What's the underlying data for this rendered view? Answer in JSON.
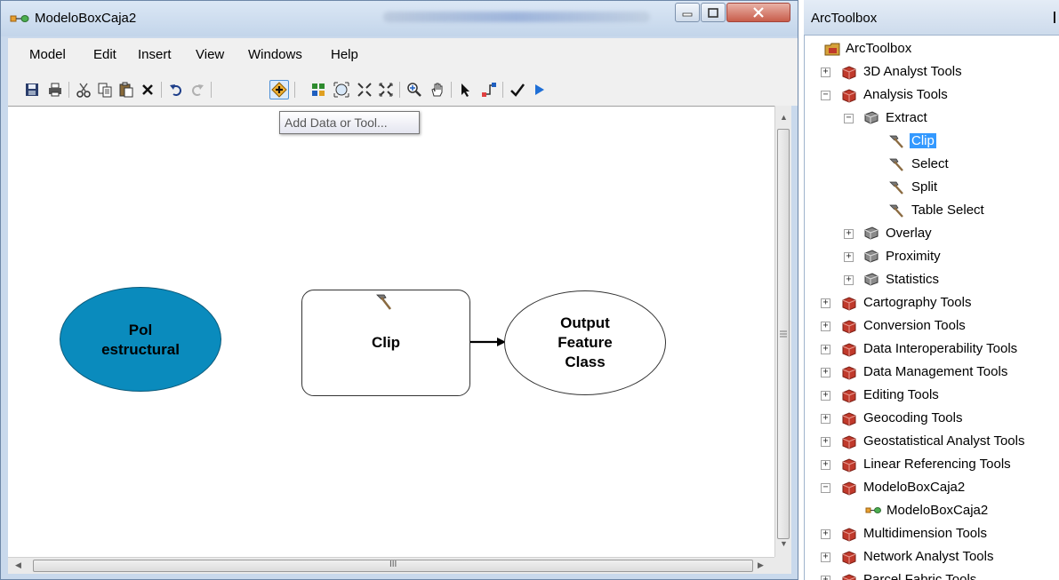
{
  "window": {
    "title": "ModeloBoxCaja2",
    "icon": "model-icon",
    "controls": [
      "minimize-icon",
      "maximize-icon",
      "close-icon"
    ]
  },
  "menu": [
    "Model",
    "Edit",
    "Insert",
    "View",
    "Windows",
    "Help"
  ],
  "toolbar": {
    "buttons": [
      "save-icon",
      "print-icon",
      "cut-icon",
      "copy-icon",
      "paste-icon",
      "delete-icon",
      "undo-icon",
      "redo-icon",
      "add-data-icon",
      "auto-layout-icon",
      "full-extent-icon",
      "zoom-in-fixed-icon",
      "zoom-out-fixed-icon",
      "zoom-in-icon",
      "pan-icon",
      "select-icon",
      "connect-icon",
      "validate-icon",
      "run-icon"
    ],
    "tooltip": "Add Data or Tool..."
  },
  "model": {
    "input": "Pol estructural",
    "tool": "Clip",
    "output": "Output Feature Class",
    "input_lines": [
      "Pol",
      "estructural"
    ],
    "output_lines": [
      "Output",
      "Feature",
      "Class"
    ]
  },
  "scrollbar": {
    "grip": "III"
  },
  "toolbox": {
    "title": "ArcToolbox",
    "root": "ArcToolbox",
    "items": [
      {
        "label": "3D Analyst Tools",
        "level": 1,
        "type": "toolbox",
        "state": "collapsed"
      },
      {
        "label": "Analysis Tools",
        "level": 1,
        "type": "toolbox",
        "state": "expanded"
      },
      {
        "label": "Extract",
        "level": 2,
        "type": "toolset",
        "state": "expanded"
      },
      {
        "label": "Clip",
        "level": 3,
        "type": "tool",
        "selected": true
      },
      {
        "label": "Select",
        "level": 3,
        "type": "tool"
      },
      {
        "label": "Split",
        "level": 3,
        "type": "tool"
      },
      {
        "label": "Table Select",
        "level": 3,
        "type": "tool"
      },
      {
        "label": "Overlay",
        "level": 2,
        "type": "toolset",
        "state": "collapsed"
      },
      {
        "label": "Proximity",
        "level": 2,
        "type": "toolset",
        "state": "collapsed"
      },
      {
        "label": "Statistics",
        "level": 2,
        "type": "toolset",
        "state": "collapsed"
      },
      {
        "label": "Cartography Tools",
        "level": 1,
        "type": "toolbox",
        "state": "collapsed"
      },
      {
        "label": "Conversion Tools",
        "level": 1,
        "type": "toolbox",
        "state": "collapsed"
      },
      {
        "label": "Data Interoperability Tools",
        "level": 1,
        "type": "toolbox",
        "state": "collapsed"
      },
      {
        "label": "Data Management Tools",
        "level": 1,
        "type": "toolbox",
        "state": "collapsed"
      },
      {
        "label": "Editing Tools",
        "level": 1,
        "type": "toolbox",
        "state": "collapsed"
      },
      {
        "label": "Geocoding Tools",
        "level": 1,
        "type": "toolbox",
        "state": "collapsed"
      },
      {
        "label": "Geostatistical Analyst Tools",
        "level": 1,
        "type": "toolbox",
        "state": "collapsed"
      },
      {
        "label": "Linear Referencing Tools",
        "level": 1,
        "type": "toolbox",
        "state": "collapsed"
      },
      {
        "label": "ModeloBoxCaja2",
        "level": 1,
        "type": "toolbox",
        "state": "expanded"
      },
      {
        "label": "ModeloBoxCaja2",
        "level": 2,
        "type": "model"
      },
      {
        "label": "Multidimension Tools",
        "level": 1,
        "type": "toolbox",
        "state": "collapsed"
      },
      {
        "label": "Network Analyst Tools",
        "level": 1,
        "type": "toolbox",
        "state": "collapsed"
      },
      {
        "label": "Parcel Fabric Tools",
        "level": 1,
        "type": "toolbox",
        "state": "collapsed"
      }
    ]
  },
  "colors": {
    "input_fill": "#0a8bbd",
    "selection": "#3399ff",
    "toolbox_icon": "#c0392b"
  }
}
